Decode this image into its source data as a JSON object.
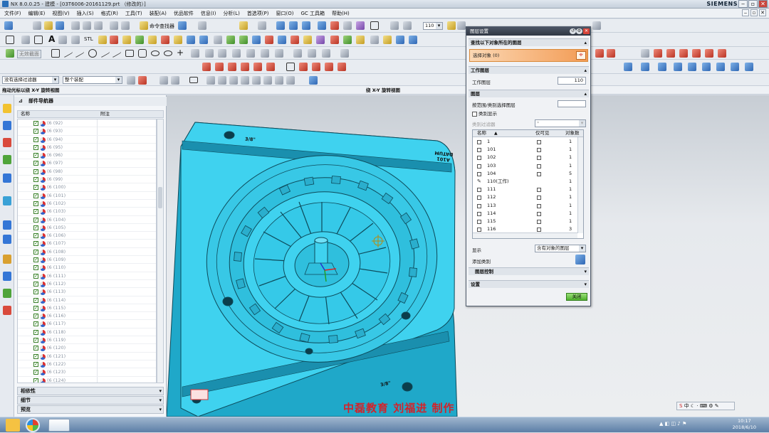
{
  "titlebar": {
    "title": "NX 8.0.0.25 - 建模 - [03T6006-20161129.prt （修改的）]",
    "brand": "SIEMENS"
  },
  "menu": [
    "文件(F)",
    "编辑(E)",
    "视图(V)",
    "插入(S)",
    "格式(R)",
    "工具(T)",
    "装配(A)",
    "优品软件",
    "信息(I)",
    "分析(L)",
    "首选项(P)",
    "窗口(O)",
    "GC 工具箱",
    "帮助(H)"
  ],
  "toolbar": {
    "command_finder": "命令查找器",
    "stl": "STL",
    "scale_value": "110",
    "wire_label": "无效截面",
    "selection_filter": "没有选择过滤器",
    "assembly_filter": "整个装配"
  },
  "cue_line": {
    "left": "拖动光标以绕 X-Y 旋转视图",
    "center": "绕 X-Y 旋转视图"
  },
  "navigator": {
    "title": "部件导航器",
    "col_name": "名称",
    "col_note": "附注",
    "items": [
      "(6 (92)",
      "(6 (93)",
      "(6 (94)",
      "(6 (95)",
      "(6 (96)",
      "(6 (97)",
      "(6 (98)",
      "(6 (99)",
      "(6 (100)",
      "(6 (101)",
      "(6 (102)",
      "(6 (103)",
      "(6 (104)",
      "(6 (105)",
      "(6 (106)",
      "(6 (107)",
      "(6 (108)",
      "(6 (109)",
      "(6 (110)",
      "(6 (111)",
      "(6 (112)",
      "(6 (113)",
      "(6 (114)",
      "(6 (115)",
      "(6 (116)",
      "(6 (117)",
      "(6 (118)",
      "(6 (119)",
      "(6 (120)",
      "(6 (121)",
      "(6 (122)",
      "(6 (123)",
      "(6 (124)"
    ],
    "panels": [
      "相依性",
      "细节",
      "预览"
    ]
  },
  "model": {
    "label_top": "3/8\"",
    "label_bottom": "3/8\"",
    "datum_label": "A101 DATUM",
    "color": "#3fd2ef"
  },
  "dialog": {
    "title": "图层设置",
    "find_section": "查找以下对象所在的图层",
    "select_object": "选择对象 (0)",
    "work_layer_section": "工作图层",
    "work_layer_label": "工作图层",
    "work_layer_value": "110",
    "layers_section": "图层",
    "range_label": "按范围/类别选择图层",
    "category_display": "类别显示",
    "category_filter_label": "类别过滤器",
    "category_filter_value": "*",
    "table_headers": [
      "名称",
      "仅可见",
      "对象数"
    ],
    "layers": [
      {
        "name": "1",
        "visible_only": true,
        "count": "1"
      },
      {
        "name": "101",
        "visible_only": true,
        "count": "1"
      },
      {
        "name": "102",
        "visible_only": true,
        "count": "1"
      },
      {
        "name": "103",
        "visible_only": true,
        "count": "1"
      },
      {
        "name": "104",
        "visible_only": true,
        "count": "5"
      },
      {
        "name": "110(工作)",
        "visible_only": false,
        "count": "1"
      },
      {
        "name": "111",
        "visible_only": true,
        "count": "1"
      },
      {
        "name": "112",
        "visible_only": true,
        "count": "1"
      },
      {
        "name": "113",
        "visible_only": true,
        "count": "1"
      },
      {
        "name": "114",
        "visible_only": true,
        "count": "1"
      },
      {
        "name": "115",
        "visible_only": true,
        "count": "1"
      },
      {
        "name": "116",
        "visible_only": true,
        "count": "3"
      }
    ],
    "display_label": "显示",
    "display_value": "含有对象的图层",
    "add_category": "添加类别",
    "layer_control": "图层控制",
    "settings": "设置",
    "close_button": "关闭"
  },
  "watermark": "中磊教育 刘福进 制作",
  "ime": "中",
  "clock": {
    "time": "10:17",
    "date": "2018/6/10"
  }
}
